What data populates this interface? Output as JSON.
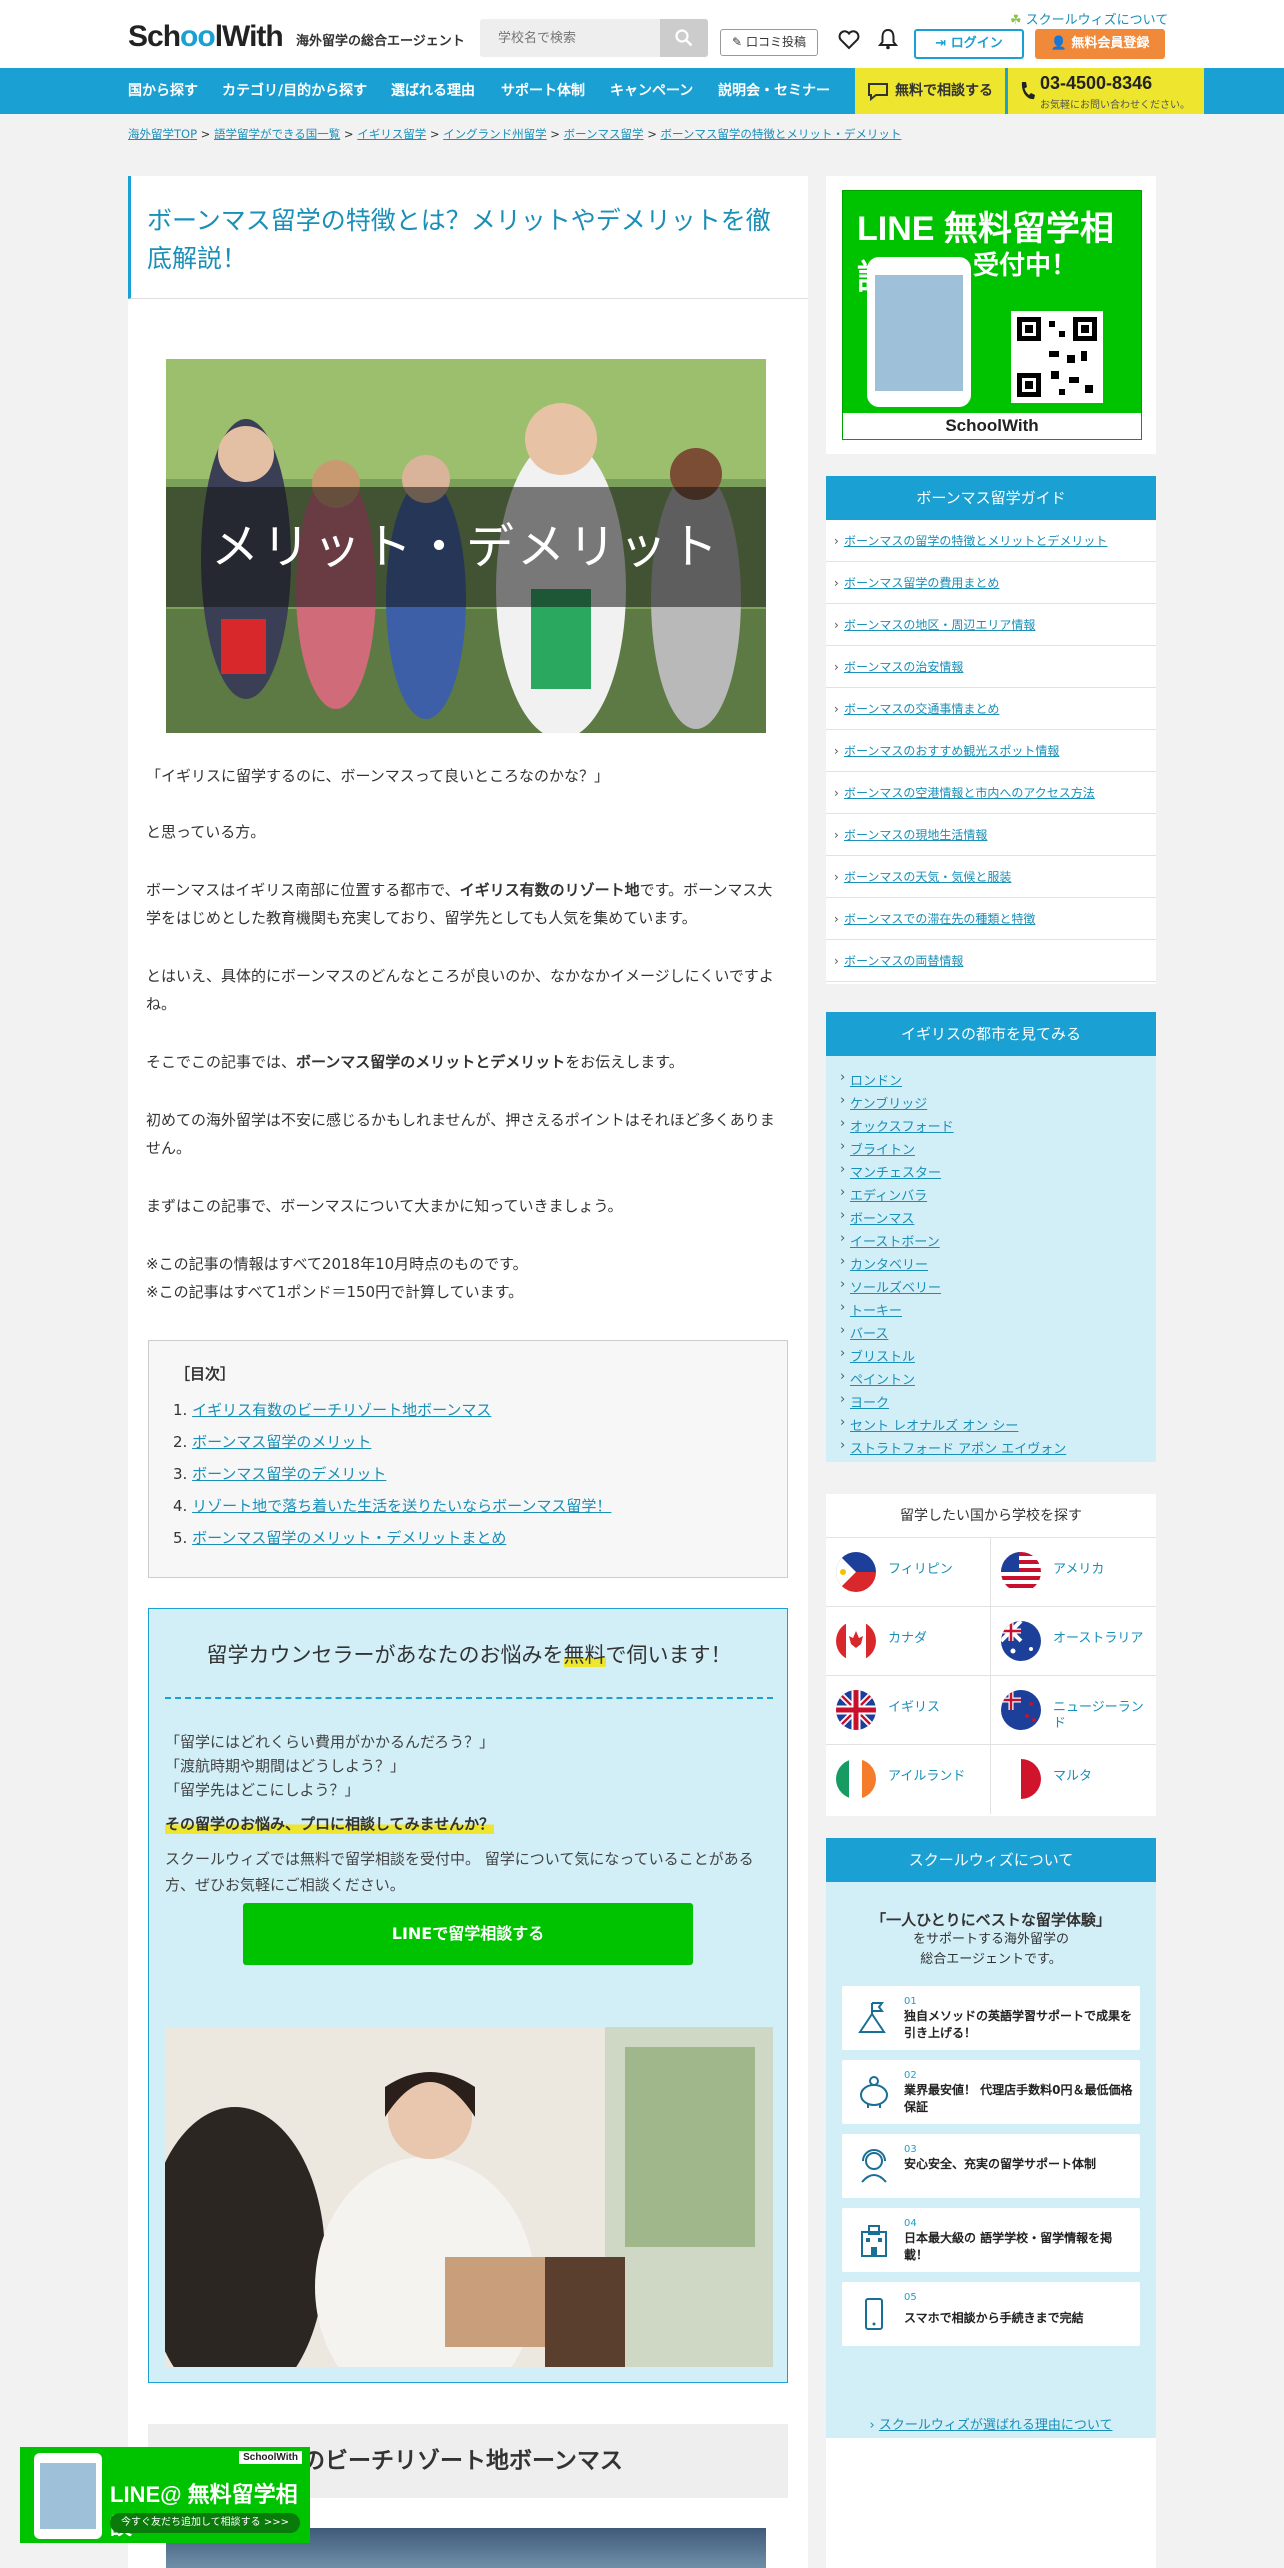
{
  "header": {
    "logo": "SchoolWith",
    "tagline": "海外留学の総合エージェント",
    "search_placeholder": "学校名で検索",
    "kuchikomi": "口コミ投稿",
    "about_link": "スクールウィズについて",
    "login": "ログイン",
    "register": "無料会員登録"
  },
  "nav": {
    "items": [
      "国から探す",
      "カテゴリ/目的から探す",
      "選ばれる理由",
      "サポート体制",
      "キャンペーン",
      "説明会・セミナー"
    ],
    "consult": "無料で相談する",
    "phone": "03-4500-8346",
    "phone_sub": "お気軽にお問い合わせください。"
  },
  "breadcrumb": [
    "海外留学TOP",
    "語学留学ができる国一覧",
    "イギリス留学",
    "イングランド州留学",
    "ボーンマス留学",
    "ボーンマス留学の特徴とメリット・デメリット"
  ],
  "article": {
    "title": "ボーンマス留学の特徴とは？メリットやデメリットを徹底解説！",
    "hero_caption": "メリット・デメリット",
    "p1": "「イギリスに留学するのに、ボーンマスって良いところなのかな？」",
    "p2": "と思っている方。",
    "p3a": "ボーンマスはイギリス南部に位置する都市で、",
    "p3b": "イギリス有数のリゾート地",
    "p3c": "です。ボーンマス大学をはじめとした教育機関も充実しており、留学先としても人気を集めています。",
    "p4": "とはいえ、具体的にボーンマスのどんなところが良いのか、なかなかイメージしにくいですよね。",
    "p5a": "そこでこの記事では、",
    "p5b": "ボーンマス留学のメリットとデメリット",
    "p5c": "をお伝えします。",
    "p6": "初めての海外留学は不安に感じるかもしれませんが、押さえるポイントはそれほど多くありません。",
    "p7": "まずはこの記事で、ボーンマスについて大まかに知っていきましょう。",
    "note1": "※この記事の情報はすべて2018年10月時点のものです。",
    "note2": "※この記事はすべて1ポンド＝150円で計算しています。",
    "toc_title": "［目次］",
    "toc": [
      "イギリス有数のビーチリゾート地ボーンマス",
      "ボーンマス留学のメリット",
      "ボーンマス留学のデメリット",
      "リゾート地で落ち着いた生活を送りたいならボーンマス留学！",
      "ボーンマス留学のメリット・デメリットまとめ"
    ],
    "toc_nums": [
      "1.",
      "2.",
      "3.",
      "4.",
      "5."
    ],
    "section1": "イギリス有数のビーチリゾート地ボーンマス"
  },
  "counsel": {
    "title_a": "留学カウンセラーがあなたのお悩みを",
    "title_hl": "無料",
    "title_b": "で伺います！",
    "q1": "「留学にはどれくらい費用がかかるんだろう？」",
    "q2": "「渡航時期や期間はどうしよう？」",
    "q3": "「留学先はどこにしよう？」",
    "strong": "その留学のお悩み、プロに相談してみませんか？",
    "text": "スクールウィズでは無料で留学相談を受付中。 留学について気になっていることがある方、ぜひお気軽にご相談ください。",
    "button": "LINEで留学相談する"
  },
  "sidebar": {
    "line_banner_1": "LINE 無料留学相談",
    "line_banner_2": "受付中！",
    "line_banner_logo": "SchoolWith",
    "guide_title": "ボーンマス留学ガイド",
    "guide": [
      "ボーンマスの留学の特徴とメリットとデメリット",
      "ボーンマス留学の費用まとめ",
      "ボーンマスの地区・周辺エリア情報",
      "ボーンマスの治安情報",
      "ボーンマスの交通事情まとめ",
      "ボーンマスのおすすめ観光スポット情報",
      "ボーンマスの空港情報と市内へのアクセス方法",
      "ボーンマスの現地生活情報",
      "ボーンマスの天気・気候と服装",
      "ボーンマスでの滞在先の種類と特徴",
      "ボーンマスの両替情報"
    ],
    "cities_title": "イギリスの都市を見てみる",
    "cities": [
      "ロンドン",
      "ケンブリッジ",
      "オックスフォード",
      "ブライトン",
      "マンチェスター",
      "エディンバラ",
      "ボーンマス",
      "イーストボーン",
      "カンタベリー",
      "ソールズベリー",
      "トーキー",
      "バース",
      "ブリストル",
      "ペイントン",
      "ヨーク",
      "セント レオナルズ オン シー",
      "ストラトフォード アポン エイヴォン"
    ],
    "countries_title": "留学したい国から学校を探す",
    "countries": [
      "フィリピン",
      "アメリカ",
      "カナダ",
      "オーストラリア",
      "イギリス",
      "ニュージーランド",
      "アイルランド",
      "マルタ"
    ],
    "about_title": "スクールウィズについて",
    "about_lead_1": "「一人ひとりにベストな留学体験」",
    "about_lead_2": "をサポートする海外留学の",
    "about_lead_3": "総合エージェントです。",
    "features": [
      {
        "no": "01",
        "text": "独自メソッドの英語学習サポートで成果を引き上げる！"
      },
      {
        "no": "02",
        "text": "業界最安値！ 代理店手数料0円＆最低価格保証"
      },
      {
        "no": "03",
        "text": "安心安全、充実の留学サポート体制"
      },
      {
        "no": "04",
        "text": "日本最大級の 語学学校・留学情報を掲載！"
      },
      {
        "no": "05",
        "text": "スマホで相談から手続きまで完結"
      }
    ],
    "about_more": "スクールウィズが選ばれる理由について",
    "line_banner2_title": "LINE@ 無料留学相談",
    "line_banner2_btn": "今すぐ友だち追加して相談する >>>"
  },
  "colors": {
    "primary": "#1aa0d2",
    "accent_yellow": "#ede52e",
    "orange": "#f08a3a",
    "line_green": "#00c300"
  }
}
